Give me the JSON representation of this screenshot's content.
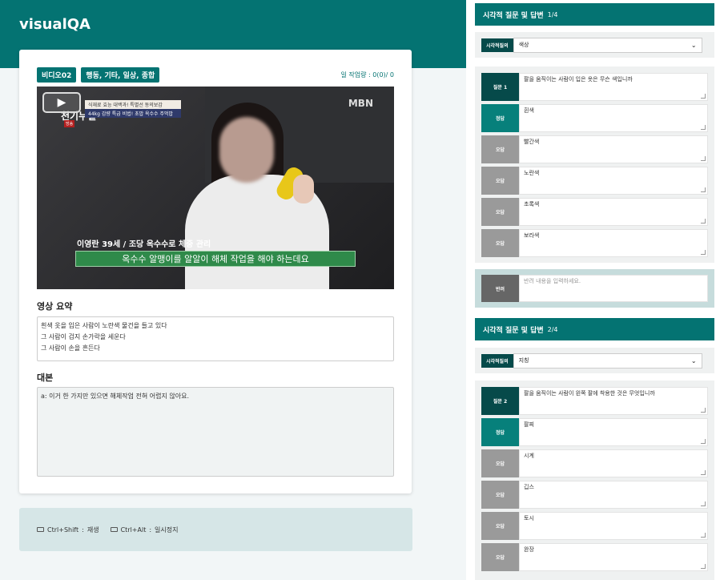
{
  "app": {
    "title": "visualQA"
  },
  "video_card": {
    "tags": [
      "비디오02",
      "행동, 기타, 일상, 종합"
    ],
    "workload": "일 작업량 : 0(0)/ 0",
    "video": {
      "channel_logo": "MBN",
      "show_logo": "천기누설",
      "show_tag": "방송",
      "promo_line1": "식재료 효능 대백과! 특별선 동의보감",
      "promo_line2": "44kg 감량 특급 비법! 초밥 옥수수 주먹밥",
      "caption_name": "이영란 39세 / 조당 옥수수로 체중 관리",
      "caption_text": "옥수수 알맹이를 알알이 해체 작업을 해야 하는데요"
    },
    "summary_label": "영상 요약",
    "summary_text": "흰색 옷을 입은 사람이 노란색 물건을 들고 있다\n그 사람이 검지 손가락을 세운다\n그 사람이 손을 흔든다",
    "script_label": "대본",
    "script_text": "a: 이거 한 가지만 있으면 해체작업 전혀 어렵지 않아요."
  },
  "hotkeys": [
    {
      "keys": "Ctrl+Shift",
      "action": "재생"
    },
    {
      "keys": "Ctrl+Alt",
      "action": "일시정지"
    }
  ],
  "panel": {
    "questions": [
      {
        "header": "시각적 질문 및 답변",
        "index": "1/4",
        "type_label": "시각적질의",
        "type_value": "색상",
        "question_label": "질문 1",
        "question": "팔을 움직이는 사람이 입은 옷은 무슨 색입니까",
        "answer_label": "정답",
        "answer": "흰색",
        "wrong_label": "오답",
        "wrong": [
          "빨간색",
          "노란색",
          "초록색",
          "보라색"
        ]
      },
      {
        "header": "시각적 질문 및 답변",
        "index": "2/4",
        "type_label": "시각적질의",
        "type_value": "지칭",
        "question_label": "질문 2",
        "question": "팔을 움직이는 사람이 왼쪽 팔에 착용한 것은 무엇입니까",
        "answer_label": "정답",
        "answer": "팔찌",
        "wrong_label": "오답",
        "wrong": [
          "시계",
          "깁스",
          "토시",
          "완장"
        ]
      }
    ],
    "memo_label": "반려",
    "memo_placeholder": "반려 내용을 입력하세요."
  },
  "colors": {
    "brand": "#047372",
    "dark": "#064a4a",
    "answer": "#07807b",
    "wrong": "#9a9a9a"
  }
}
